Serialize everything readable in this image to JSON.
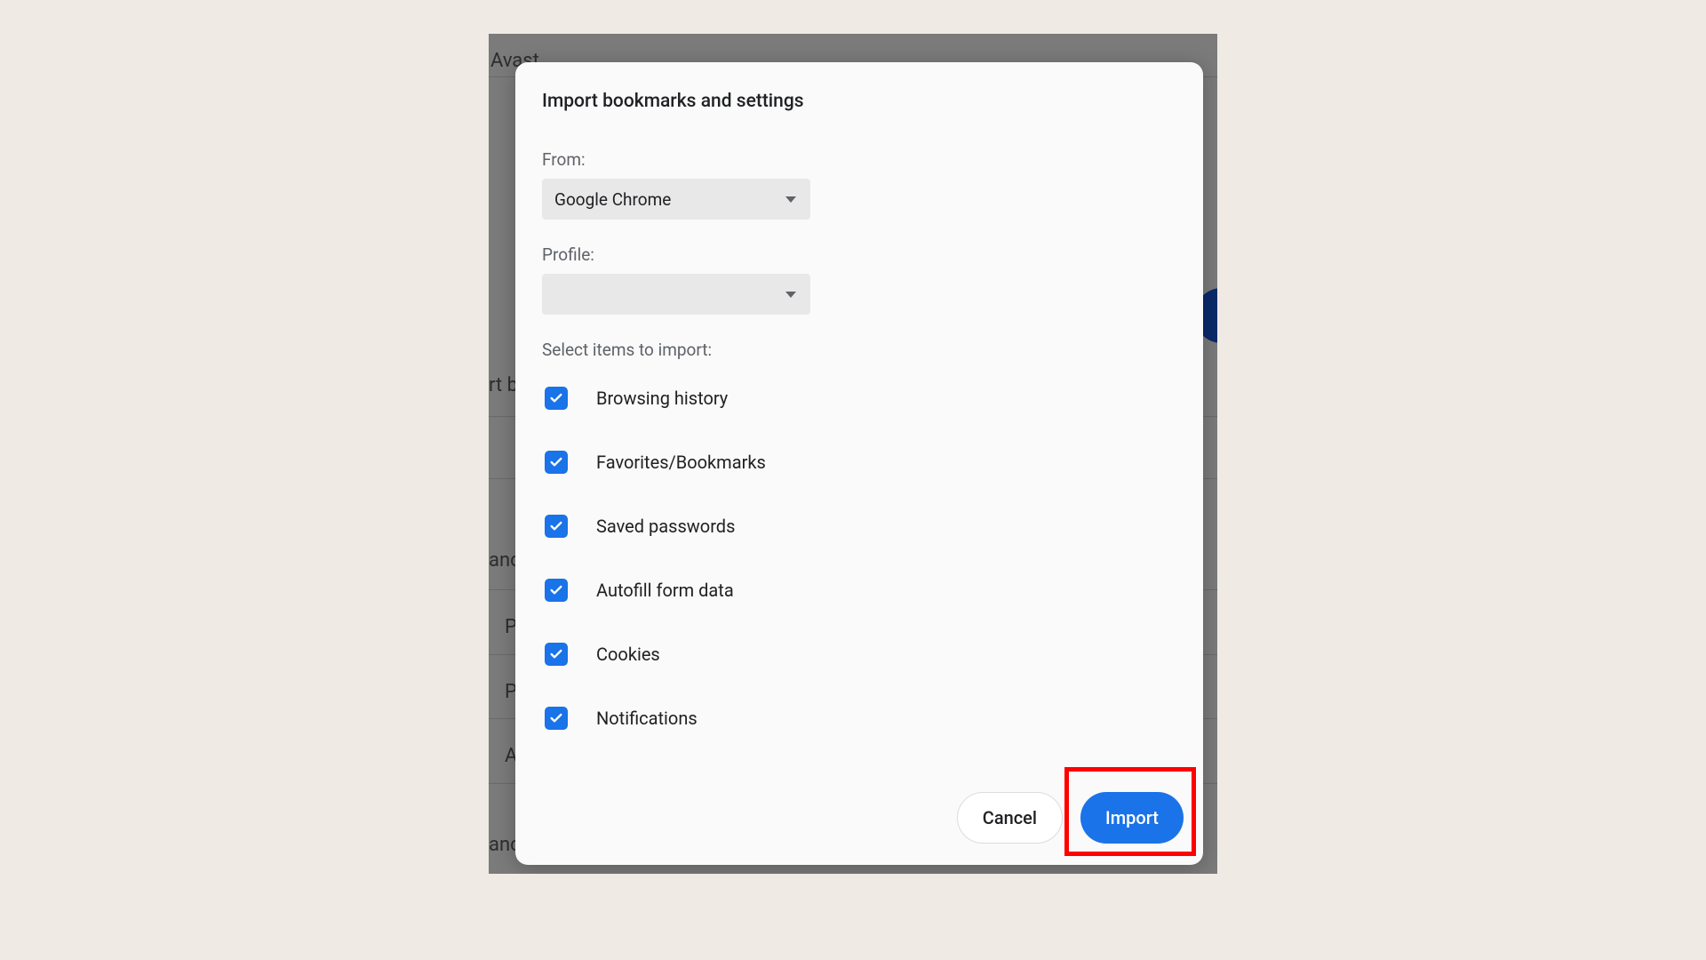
{
  "background": {
    "app_name": "Avast",
    "fragments": {
      "rt_bo": "rt bo",
      "anc1": "anc",
      "pa1": "Pa",
      "pa2": "Pa",
      "ac": "Ac",
      "anc2": "anc"
    }
  },
  "dialog": {
    "title": "Import bookmarks and settings",
    "from_label": "From:",
    "from_value": "Google Chrome",
    "profile_label": "Profile:",
    "profile_value": "",
    "select_label": "Select items to import:",
    "items": [
      {
        "label": "Browsing history",
        "checked": true
      },
      {
        "label": "Favorites/Bookmarks",
        "checked": true
      },
      {
        "label": "Saved passwords",
        "checked": true
      },
      {
        "label": "Autofill form data",
        "checked": true
      },
      {
        "label": "Cookies",
        "checked": true
      },
      {
        "label": "Notifications",
        "checked": true
      }
    ],
    "buttons": {
      "cancel": "Cancel",
      "import": "Import"
    }
  },
  "highlight": {
    "target": "import-button"
  }
}
